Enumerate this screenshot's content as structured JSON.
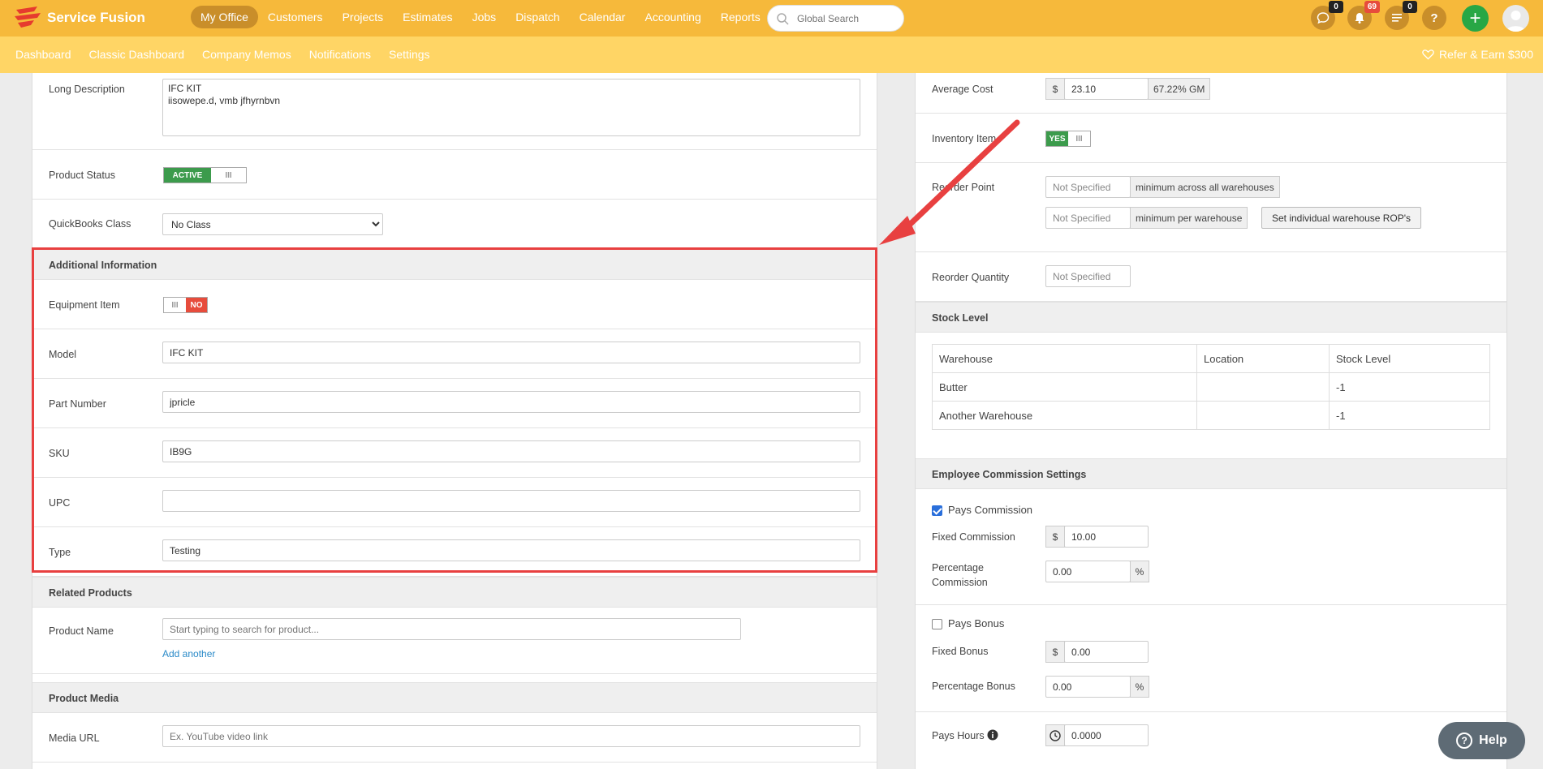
{
  "brand": {
    "name": "Service Fusion"
  },
  "nav": {
    "items": [
      "My Office",
      "Customers",
      "Projects",
      "Estimates",
      "Jobs",
      "Dispatch",
      "Calendar",
      "Accounting",
      "Reports"
    ],
    "active": "My Office"
  },
  "search": {
    "placeholder": "Global Search"
  },
  "badges": {
    "chat": "0",
    "notifications": "69",
    "tasks": "0",
    "help": "?"
  },
  "subnav": {
    "items": [
      "Dashboard",
      "Classic Dashboard",
      "Company Memos",
      "Notifications",
      "Settings"
    ],
    "refer": "Refer & Earn $300"
  },
  "left": {
    "long_description": {
      "label": "Long Description",
      "value": "IFC KIT\niisowepe.d, vmb jfhyrnbvn"
    },
    "product_status": {
      "label": "Product Status",
      "on": "ACTIVE",
      "handle": "III"
    },
    "quickbooks_class": {
      "label": "QuickBooks Class",
      "value": "No Class"
    },
    "additional_info": {
      "title": "Additional Information",
      "equipment_item": {
        "label": "Equipment Item",
        "handle": "III",
        "off": "NO"
      },
      "model": {
        "label": "Model",
        "value": "IFC KIT"
      },
      "part_number": {
        "label": "Part Number",
        "value": "jpricle"
      },
      "sku": {
        "label": "SKU",
        "value": "IB9G"
      },
      "upc": {
        "label": "UPC",
        "value": ""
      },
      "type": {
        "label": "Type",
        "value": "Testing"
      }
    },
    "related_products": {
      "title": "Related Products",
      "product_name": {
        "label": "Product Name",
        "placeholder": "Start typing to search for product..."
      },
      "add_another": "Add another"
    },
    "product_media": {
      "title": "Product Media",
      "media_url": {
        "label": "Media URL",
        "placeholder": "Ex. YouTube video link"
      }
    }
  },
  "right": {
    "average_cost": {
      "label": "Average Cost",
      "prefix": "$",
      "value": "23.10",
      "gm": "67.22% GM"
    },
    "inventory_item": {
      "label": "Inventory Item",
      "on": "YES",
      "handle": "III"
    },
    "reorder_point": {
      "label": "Reorder Point",
      "field1": "Not Specified",
      "addon1": "minimum across all warehouses",
      "field2": "Not Specified",
      "addon2": "minimum per warehouse",
      "button": "Set individual warehouse ROP's"
    },
    "reorder_quantity": {
      "label": "Reorder Quantity",
      "value": "Not Specified"
    },
    "stock_level": {
      "title": "Stock Level",
      "headers": [
        "Warehouse",
        "Location",
        "Stock Level"
      ],
      "rows": [
        [
          "Butter",
          "",
          "-1"
        ],
        [
          "Another Warehouse",
          "",
          "-1"
        ]
      ]
    },
    "commission": {
      "title": "Employee Commission Settings",
      "pays_commission": {
        "label": "Pays Commission",
        "checked": true
      },
      "fixed_commission": {
        "label": "Fixed Commission",
        "prefix": "$",
        "value": "10.00"
      },
      "percentage_commission": {
        "label": "Percentage Commission",
        "value": "0.00",
        "suffix": "%"
      },
      "pays_bonus": {
        "label": "Pays Bonus",
        "checked": false
      },
      "fixed_bonus": {
        "label": "Fixed Bonus",
        "prefix": "$",
        "value": "0.00"
      },
      "percentage_bonus": {
        "label": "Percentage Bonus",
        "value": "0.00",
        "suffix": "%"
      },
      "pays_hours": {
        "label": "Pays Hours",
        "value": "0.0000"
      }
    }
  },
  "help": {
    "label": "Help",
    "icon": "?"
  },
  "colors": {
    "topbar": "#f6b93b",
    "subbar": "#ffd565",
    "highlight": "#e84040",
    "active_green": "#3c9b4c"
  }
}
